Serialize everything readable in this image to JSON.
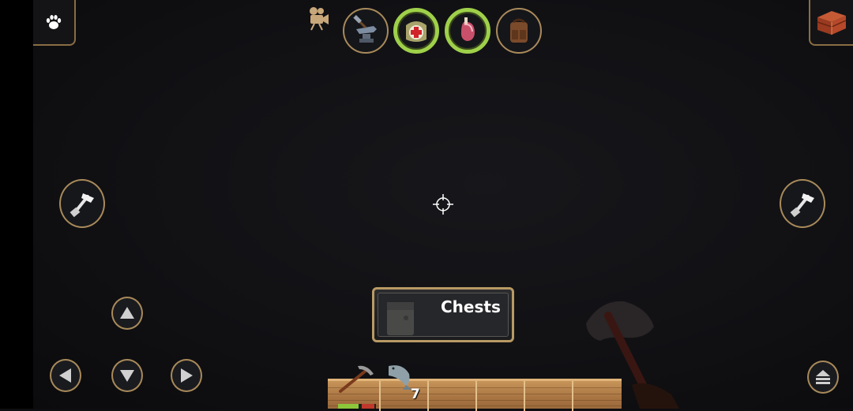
{
  "pickup": {
    "label": "Chests"
  },
  "hotbar": {
    "slot_count": "7"
  },
  "icons": {
    "corner_left": "paw-icon",
    "corner_right": "chest-icon",
    "camera": "movie-camera-icon",
    "top_buttons": [
      "crafting-anvil-icon",
      "medkit-icon",
      "food-ham-icon",
      "backpack-icon"
    ],
    "left_tool": "hammer-icon",
    "right_tool": "hammer-icon",
    "dpad": [
      "arrow-up-icon",
      "arrow-left-icon",
      "arrow-down-icon",
      "arrow-right-icon"
    ],
    "menu": "eject-menu-icon"
  },
  "colors": {
    "accent_border": "#a98a5a",
    "active_ring": "#9fd04a",
    "hotbar_wood": "#b07c48",
    "health_green": "#8cc63a",
    "health_red": "#c0392b"
  }
}
